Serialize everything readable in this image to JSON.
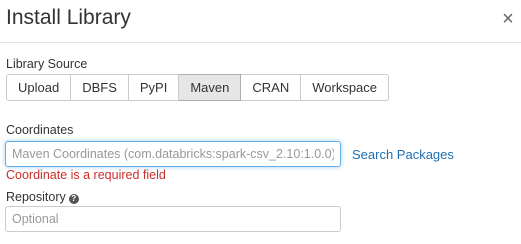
{
  "dialog": {
    "title": "Install Library",
    "close_glyph": "×"
  },
  "library_source": {
    "label": "Library Source",
    "options": [
      "Upload",
      "DBFS",
      "PyPI",
      "Maven",
      "CRAN",
      "Workspace"
    ],
    "selected": "Maven"
  },
  "coordinates": {
    "label": "Coordinates",
    "value": "",
    "placeholder": "Maven Coordinates (com.databricks:spark-csv_2.10:1.0.0)",
    "search_link": "Search Packages",
    "error": "Coordinate is a required field"
  },
  "repository": {
    "label": "Repository",
    "help_icon": "question-circle-icon",
    "help_glyph": "?",
    "value": "",
    "placeholder": "Optional"
  },
  "colors": {
    "error": "#c9302c",
    "link": "#1f6fb2",
    "selected_tab_bg": "#e6e6e6",
    "focus_border": "#66afe9"
  }
}
